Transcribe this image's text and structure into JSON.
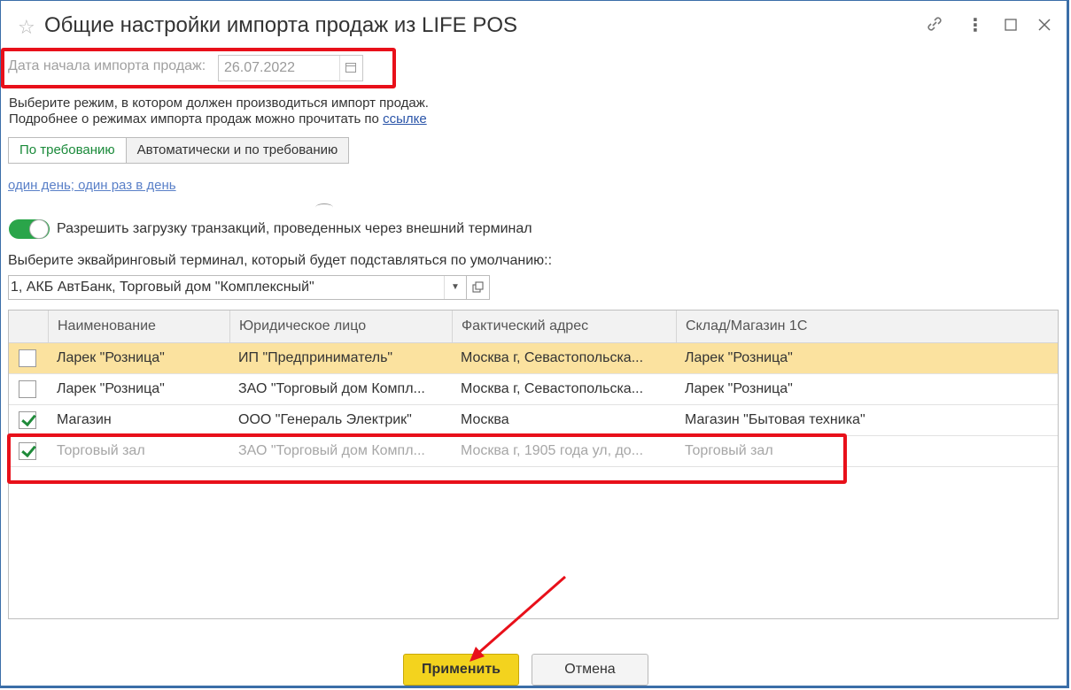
{
  "window": {
    "title": "Общие настройки импорта продаж из LIFE POS",
    "icons": [
      "star-icon",
      "link-icon",
      "more-icon",
      "maximize-icon",
      "close-icon"
    ]
  },
  "date": {
    "label": "Дата начала импорта продаж:",
    "value": "26.07.2022"
  },
  "info": {
    "line1": "Выберите режим, в котором должен производиться импорт продаж.",
    "line2": "Подробнее о режимах импорта продаж можно прочитать по ",
    "link": "ссылке"
  },
  "modes": {
    "options": [
      "По требованию",
      "Автоматически и по требованию"
    ],
    "active": "По требованию"
  },
  "schedule_link": "один день; один раз в день",
  "toggle": {
    "label": "Разрешить загрузку транзакций, проведенных через внешний терминал",
    "on": true
  },
  "terminal": {
    "label": "Выберите эквайринговый терминал, который будет подставляться по умолчанию::",
    "value": "1, АКБ АвтБанк, Торговый дом \"Комплексный\""
  },
  "table": {
    "columns": [
      "Наименование",
      "Юридическое лицо",
      "Фактический адрес",
      "Склад/Магазин 1С"
    ],
    "rows": [
      {
        "checked": false,
        "name": "Ларек \"Розница\"",
        "legal": "ИП \"Предприниматель\"",
        "address": "Москва г, Севастопольска...",
        "store": "Ларек \"Розница\""
      },
      {
        "checked": false,
        "name": "Ларек \"Розница\"",
        "legal": "ЗАО \"Торговый дом Компл...",
        "address": "Москва г, Севастопольска...",
        "store": "Ларек \"Розница\""
      },
      {
        "checked": true,
        "name": "Магазин",
        "legal": "ООО \"Генераль Электрик\"",
        "address": "Москва",
        "store": "Магазин \"Бытовая техника\""
      },
      {
        "checked": true,
        "name": "Торговый зал",
        "legal": "ЗАО \"Торговый дом Компл...",
        "address": "Москва г, 1905 года ул, до...",
        "store": "Торговый зал"
      }
    ]
  },
  "buttons": {
    "apply": "Применить",
    "cancel": "Отмена"
  },
  "colors": {
    "highlight": "#e8101a",
    "accent_green": "#1f8a3a",
    "selected_row": "#fbe29f",
    "apply_button": "#f3d31e"
  }
}
